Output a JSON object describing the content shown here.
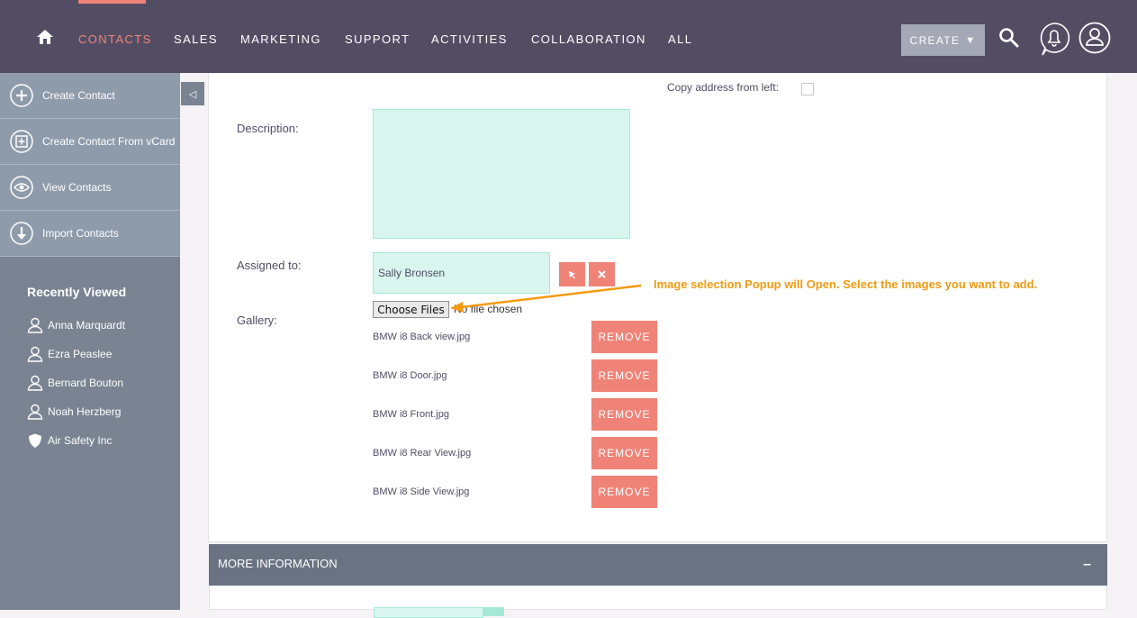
{
  "nav": {
    "items": [
      "Contacts",
      "Sales",
      "Marketing",
      "Support",
      "Activities",
      "Collaboration",
      "All"
    ],
    "active": "Contacts",
    "create_label": "CREATE",
    "accent": "#f08377",
    "bg": "#534d64"
  },
  "sidebar": {
    "actions": [
      {
        "label": "Create Contact",
        "icon": "plus-circle-icon"
      },
      {
        "label": "Create Contact From vCard",
        "icon": "vcard-plus-icon"
      },
      {
        "label": "View Contacts",
        "icon": "eye-icon"
      },
      {
        "label": "Import Contacts",
        "icon": "download-arrow-icon"
      }
    ],
    "recent_title": "Recently Viewed",
    "recent": [
      {
        "label": "Anna Marquardt",
        "icon": "person-icon"
      },
      {
        "label": "Ezra Peaslee",
        "icon": "person-icon"
      },
      {
        "label": "Bernard Bouton",
        "icon": "person-icon"
      },
      {
        "label": "Noah Herzberg",
        "icon": "person-icon"
      },
      {
        "label": "Air Safety Inc",
        "icon": "shield-icon"
      }
    ]
  },
  "form": {
    "copy_address_label": "Copy address from left:",
    "description_label": "Description:",
    "description_value": "",
    "assigned_label": "Assigned to:",
    "assigned_value": "Sally Bronsen",
    "gallery_label": "Gallery:",
    "choose_files_label": "Choose Files",
    "no_file_text": "No file chosen",
    "remove_label": "REMOVE",
    "gallery_files": [
      "BMW i8 Back view.jpg",
      "BMW i8 Door.jpg",
      "BMW i8 Front.jpg",
      "BMW i8 Rear View.jpg",
      "BMW i8 Side View.jpg"
    ]
  },
  "annotation": {
    "text": "Image selection Popup will Open. Select the images you want to add.",
    "color": "#f29b12"
  },
  "more_info": {
    "title": "MORE INFORMATION",
    "toggle": "–"
  }
}
